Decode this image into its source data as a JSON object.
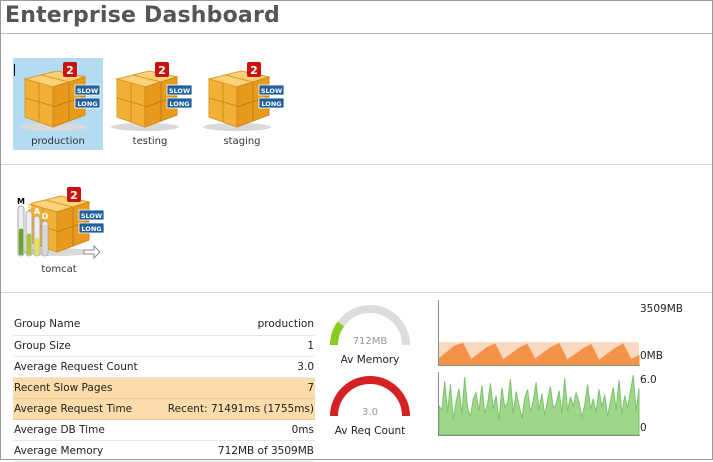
{
  "header": {
    "title": "Enterprise Dashboard"
  },
  "groups": [
    {
      "name": "production",
      "badge": "2",
      "tag_slow": "SLOW",
      "tag_long": "LONG",
      "selected": true
    },
    {
      "name": "testing",
      "badge": "2",
      "tag_slow": "SLOW",
      "tag_long": "LONG",
      "selected": false
    },
    {
      "name": "staging",
      "badge": "2",
      "tag_slow": "SLOW",
      "tag_long": "LONG",
      "selected": false
    }
  ],
  "servers": [
    {
      "name": "tomcat",
      "badge": "2",
      "tag_slow": "SLOW",
      "tag_long": "LONG",
      "meter_letters": [
        "M",
        "S",
        "A",
        "D"
      ]
    }
  ],
  "details": {
    "rows": [
      {
        "label": "Group Name",
        "value": "production",
        "highlight": false
      },
      {
        "label": "Group Size",
        "value": "1",
        "highlight": false
      },
      {
        "label": "Average Request Count",
        "value": "3.0",
        "highlight": false
      },
      {
        "label": "Recent Slow Pages",
        "value": "7",
        "highlight": true
      },
      {
        "label": "Average Request Time",
        "value": "Recent: 71491ms (1755ms)",
        "highlight": true
      },
      {
        "label": "Average DB Time",
        "value": "0ms",
        "highlight": false
      },
      {
        "label": "Average Memory",
        "value": "712MB of 3509MB",
        "highlight": false
      }
    ]
  },
  "gauges": [
    {
      "value_text": "712MB",
      "caption": "Av Memory",
      "fraction": 0.2,
      "color": "#88cc22"
    },
    {
      "value_text": "3.0",
      "caption": "Av Req Count",
      "fraction": 1.0,
      "color": "#d42222"
    }
  ],
  "colors": {
    "accent_badge": "#cc1111",
    "tag_bg": "#1f5f9e",
    "highlight": "#fbdcaa"
  },
  "chart_data": [
    {
      "type": "area",
      "ymax_label": "3509MB",
      "ymin_label": "0MB",
      "ylim": [
        0,
        3509
      ],
      "band": [
        0,
        1250
      ],
      "values": [
        350,
        700,
        1050,
        1180,
        300,
        620,
        950,
        1150,
        280,
        600,
        920,
        1150,
        320,
        640,
        960,
        1180,
        280,
        560,
        880,
        1120,
        250,
        580,
        900,
        1150,
        300,
        520
      ],
      "fill_color": "#f5924a",
      "band_color": "#fcd9be"
    },
    {
      "type": "area",
      "ymax_label": "6.0",
      "ymin_label": "0",
      "ylim": [
        0,
        6
      ],
      "values": [
        2.8,
        2.4,
        5.2,
        2.2,
        4.9,
        1.5,
        3.2,
        4.5,
        2.0,
        5.6,
        2.6,
        1.8,
        3.5,
        4.1,
        2.3,
        4.8,
        2.1,
        3.0,
        5.0,
        2.5,
        3.8,
        1.4,
        4.6,
        2.7,
        3.1,
        5.4,
        2.0,
        4.2,
        2.9,
        1.6,
        3.6,
        4.4,
        2.2,
        3.3,
        5.1,
        2.4,
        4.0,
        1.9,
        3.4,
        4.7,
        2.6,
        3.0,
        4.3,
        2.1,
        5.5,
        2.3,
        3.7,
        2.8,
        4.1,
        3.2,
        1.7,
        2.9,
        4.9,
        2.5,
        3.5,
        2.2,
        4.4,
        2.7,
        3.9,
        1.8,
        3.3,
        4.6,
        2.4,
        5.3,
        2.0,
        3.8,
        2.6,
        4.2,
        5.8,
        2.3,
        4.5
      ],
      "fill_color": "#9ed68a",
      "line_color": "#7cc36a"
    }
  ]
}
